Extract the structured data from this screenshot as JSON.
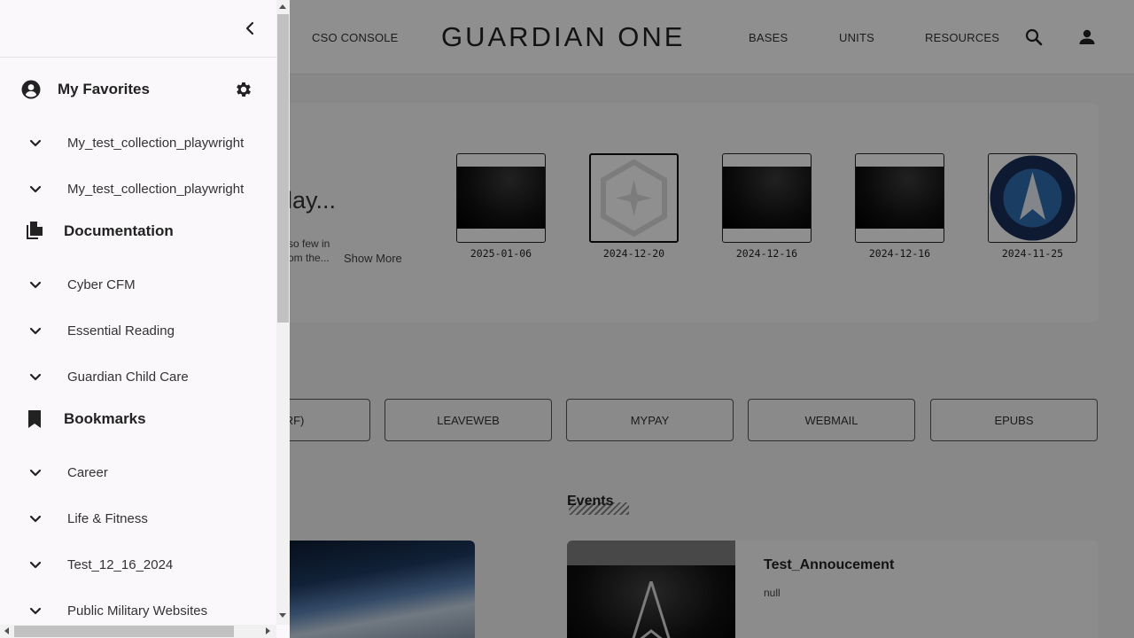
{
  "topnav": {
    "cso_console": "CSO CONSOLE",
    "brand": "GUARDIAN ONE",
    "bases": "BASES",
    "units": "UNITS",
    "resources": "RESOURCES",
    "search_icon": "search-icon",
    "account_icon": "account-icon"
  },
  "hero": {
    "title": "hday...",
    "desc_line1": "so few in",
    "desc_line2": "om the...",
    "show_more": "Show More",
    "thumbnails": [
      {
        "date": "2025-01-06",
        "style": "dark"
      },
      {
        "date": "2024-12-20",
        "style": "light"
      },
      {
        "date": "2024-12-16",
        "style": "dark"
      },
      {
        "date": "2024-12-16",
        "style": "dark"
      },
      {
        "date": "2024-11-25",
        "style": "seal"
      }
    ]
  },
  "quick_links": [
    "SURF)",
    "LEAVEWEB",
    "MYPAY",
    "WEBMAIL",
    "EPUBS"
  ],
  "events": {
    "heading": "Events",
    "card_title": "Test_Annoucement",
    "card_body": "null"
  },
  "drawer": {
    "favorites": {
      "label": "My Favorites",
      "items": [
        "My_test_collection_playwright",
        "My_test_collection_playwright"
      ]
    },
    "documentation": {
      "label": "Documentation",
      "items": [
        "Cyber CFM",
        "Essential Reading",
        "Guardian Child Care"
      ]
    },
    "bookmarks": {
      "label": "Bookmarks",
      "items": [
        "Career",
        "Life & Fitness",
        "Test_12_16_2024",
        "Public Military Websites"
      ]
    }
  },
  "colors": {
    "overlay": "#00000070",
    "drawer_bg": "#faf8fa",
    "text_dark": "#222222"
  }
}
